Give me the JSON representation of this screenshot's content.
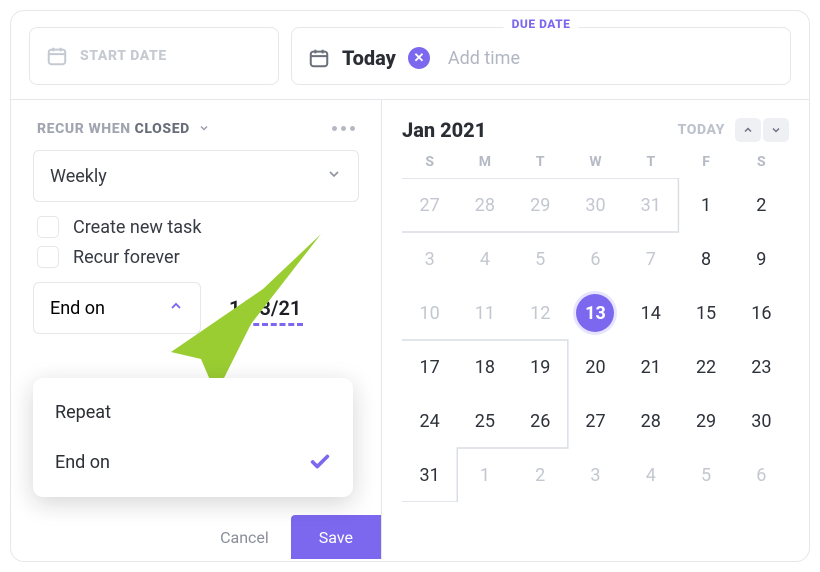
{
  "top": {
    "start_label": "START DATE",
    "due_tag": "DUE DATE",
    "due_value": "Today",
    "add_time": "Add time",
    "clear_glyph": "✕"
  },
  "recur": {
    "label": "RECUR WHEN",
    "value": "CLOSED",
    "freq": "Weekly",
    "create_new": "Create new task",
    "forever": "Recur forever",
    "end_on_label": "End on",
    "end_on_date": "1/13/21"
  },
  "popover": {
    "repeat": "Repeat",
    "end_on": "End on"
  },
  "footer": {
    "cancel": "Cancel",
    "save": "Save"
  },
  "calendar": {
    "month": "Jan 2021",
    "today_label": "TODAY",
    "dow": [
      "S",
      "M",
      "T",
      "W",
      "T",
      "F",
      "S"
    ],
    "days": [
      {
        "n": 27,
        "out": true
      },
      {
        "n": 28,
        "out": true
      },
      {
        "n": 29,
        "out": true
      },
      {
        "n": 30,
        "out": true
      },
      {
        "n": 31,
        "out": true
      },
      {
        "n": 1
      },
      {
        "n": 2
      },
      {
        "n": 3,
        "out": true
      },
      {
        "n": 4,
        "out": true
      },
      {
        "n": 5,
        "out": true
      },
      {
        "n": 6,
        "out": true
      },
      {
        "n": 7,
        "out": true
      },
      {
        "n": 8
      },
      {
        "n": 9
      },
      {
        "n": 10,
        "out": true
      },
      {
        "n": 11,
        "out": true
      },
      {
        "n": 12,
        "out": true
      },
      {
        "n": 13,
        "sel": true
      },
      {
        "n": 14
      },
      {
        "n": 15
      },
      {
        "n": 16
      },
      {
        "n": 17
      },
      {
        "n": 18
      },
      {
        "n": 19
      },
      {
        "n": 20
      },
      {
        "n": 21
      },
      {
        "n": 22
      },
      {
        "n": 23
      },
      {
        "n": 24
      },
      {
        "n": 25
      },
      {
        "n": 26
      },
      {
        "n": 27
      },
      {
        "n": 28
      },
      {
        "n": 29
      },
      {
        "n": 30
      },
      {
        "n": 31
      },
      {
        "n": 1,
        "out": true
      },
      {
        "n": 2,
        "out": true
      },
      {
        "n": 3,
        "out": true
      },
      {
        "n": 4,
        "out": true
      },
      {
        "n": 5,
        "out": true
      },
      {
        "n": 6,
        "out": true
      }
    ]
  },
  "colors": {
    "accent": "#7b68ee",
    "arrow": "#9acd32"
  }
}
